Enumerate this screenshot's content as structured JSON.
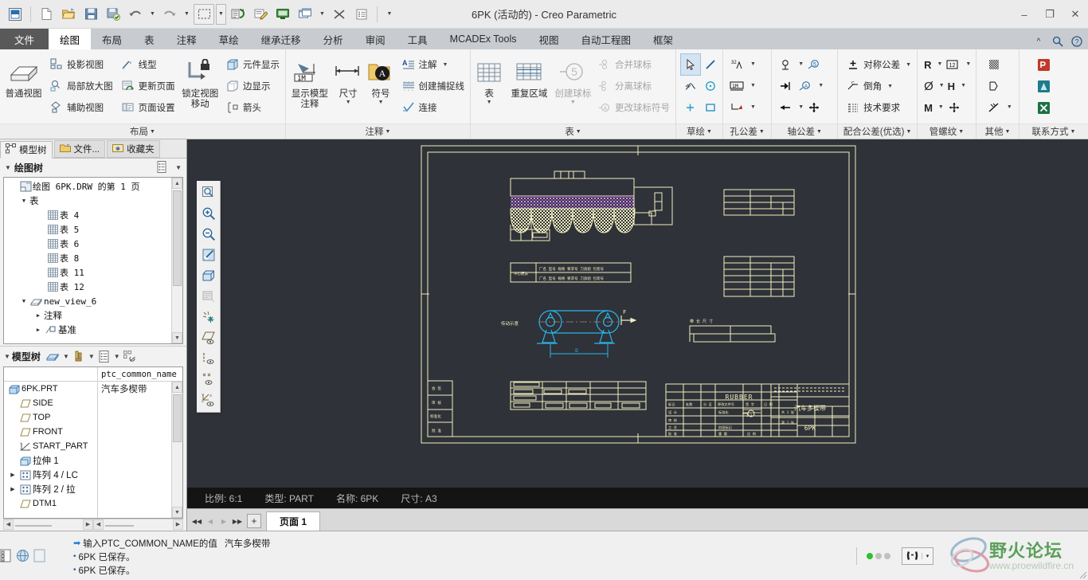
{
  "window": {
    "title": "6PK (活动的) - Creo Parametric",
    "minimize": "–",
    "maximize": "❐",
    "close": "✕"
  },
  "quick_access": {
    "items": [
      {
        "name": "app-menu-icon",
        "glyph": "app"
      },
      {
        "name": "new-icon",
        "glyph": "new"
      },
      {
        "name": "open-icon",
        "glyph": "open"
      },
      {
        "name": "save-icon",
        "glyph": "save"
      },
      {
        "name": "save-as-icon",
        "glyph": "saveas"
      },
      {
        "name": "undo-icon",
        "glyph": "undo"
      },
      {
        "name": "redo-icon",
        "glyph": "redo"
      },
      {
        "name": "select-box-icon",
        "glyph": "selbox"
      },
      {
        "name": "regenerate-icon",
        "glyph": "regen"
      },
      {
        "name": "annotate-icon",
        "glyph": "annot"
      },
      {
        "name": "display-icon",
        "glyph": "disp"
      },
      {
        "name": "window-icon",
        "glyph": "win"
      },
      {
        "name": "close-window-icon",
        "glyph": "closewin"
      },
      {
        "name": "list-icon",
        "glyph": "list"
      },
      {
        "name": "qat-overflow-icon",
        "glyph": "caret"
      }
    ]
  },
  "ribbon": {
    "tabs": [
      {
        "label": "文件",
        "id": "file",
        "state": "file"
      },
      {
        "label": "绘图",
        "id": "draw",
        "state": "active"
      },
      {
        "label": "布局",
        "id": "layout",
        "state": "normal"
      },
      {
        "label": "表",
        "id": "table",
        "state": "normal"
      },
      {
        "label": "注释",
        "id": "annotate",
        "state": "normal"
      },
      {
        "label": "草绘",
        "id": "sketch",
        "state": "normal"
      },
      {
        "label": "继承迁移",
        "id": "inherit",
        "state": "normal"
      },
      {
        "label": "分析",
        "id": "analysis",
        "state": "normal"
      },
      {
        "label": "审阅",
        "id": "review",
        "state": "normal"
      },
      {
        "label": "工具",
        "id": "tools",
        "state": "normal"
      },
      {
        "label": "MCADEx Tools",
        "id": "mcadex",
        "state": "normal"
      },
      {
        "label": "视图",
        "id": "view",
        "state": "normal"
      },
      {
        "label": "自动工程图",
        "id": "autodrawing",
        "state": "normal"
      },
      {
        "label": "框架",
        "id": "frame",
        "state": "normal"
      }
    ],
    "tab_right_icons": [
      {
        "name": "ribbon-collapse-icon",
        "glyph": "^"
      },
      {
        "name": "search-icon",
        "glyph": "search"
      },
      {
        "name": "help-icon",
        "glyph": "?"
      }
    ],
    "groups": [
      {
        "id": "layout",
        "label": "布局",
        "has_dialog_launcher": true,
        "big_button": {
          "label_line1": "普通视图",
          "label_line2": "",
          "icon": "general-view-icon"
        },
        "columns": [
          {
            "items": [
              {
                "label": "投影视图",
                "icon": "projection-view-icon",
                "enabled": true
              },
              {
                "label": "局部放大图",
                "icon": "detailed-view-icon",
                "enabled": true
              },
              {
                "label": "辅助视图",
                "icon": "auxiliary-view-icon",
                "enabled": true
              }
            ]
          },
          {
            "items": [
              {
                "label": "线型",
                "icon": "line-style-icon",
                "enabled": true
              },
              {
                "label": "更新页面",
                "icon": "update-sheet-icon",
                "enabled": true
              },
              {
                "label": "页面设置",
                "icon": "page-setup-icon",
                "enabled": true
              }
            ]
          }
        ],
        "big_button2": {
          "label_line1": "锁定视图",
          "label_line2": "移动",
          "icon": "lock-view-movement-icon"
        },
        "columns2": [
          {
            "items": [
              {
                "label": "元件显示",
                "icon": "component-display-icon",
                "enabled": true
              },
              {
                "label": "边显示",
                "icon": "edge-display-icon",
                "enabled": true
              },
              {
                "label": "箭头",
                "icon": "arrows-icon",
                "enabled": true
              }
            ]
          }
        ]
      },
      {
        "id": "annotation",
        "label": "注释",
        "has_dialog_launcher": true,
        "big_buttons": [
          {
            "label_line1": "显示模型",
            "label_line2": "注释",
            "icon": "show-model-annotations-icon",
            "caret": false
          },
          {
            "label_line1": "尺寸",
            "label_line2": "",
            "icon": "dimension-icon",
            "caret": true
          },
          {
            "label_line1": "符号",
            "label_line2": "",
            "icon": "symbol-icon",
            "caret": true
          }
        ],
        "columns": [
          {
            "items": [
              {
                "label": "注解",
                "icon": "note-icon",
                "enabled": true,
                "caret": true
              },
              {
                "label": "创建捕捉线",
                "icon": "create-snap-line-icon",
                "enabled": true
              },
              {
                "label": "连接",
                "icon": "connect-icon",
                "enabled": true
              }
            ]
          }
        ]
      },
      {
        "id": "table",
        "label": "表",
        "has_dialog_launcher": true,
        "big_buttons": [
          {
            "label_line1": "表",
            "label_line2": "",
            "icon": "table-icon",
            "caret": true
          },
          {
            "label_line1": "重复区域",
            "label_line2": "",
            "icon": "repeat-region-icon",
            "caret": false
          },
          {
            "label_line1": "创建球标",
            "label_line2": "",
            "icon": "create-balloon-icon",
            "caret": true,
            "enabled": false
          }
        ],
        "columns": [
          {
            "items": [
              {
                "label": "合并球标",
                "icon": "merge-balloons-icon",
                "enabled": false
              },
              {
                "label": "分离球标",
                "icon": "split-balloons-icon",
                "enabled": false
              },
              {
                "label": "更改球标符号",
                "icon": "change-balloon-symbol-icon",
                "enabled": false
              }
            ]
          }
        ]
      },
      {
        "id": "sketch",
        "label": "草绘",
        "has_dialog_launcher": true,
        "icon_grid": [
          [
            {
              "name": "select-tool-icon",
              "selected": true
            },
            {
              "name": "line-tool-icon",
              "selected": false
            }
          ],
          [
            {
              "name": "spline-tool-icon",
              "selected": false
            },
            {
              "name": "circle-tool-icon",
              "selected": false
            }
          ],
          [
            {
              "name": "point-tool-icon",
              "selected": false
            },
            {
              "name": "rectangle-tool-icon",
              "selected": false
            }
          ]
        ]
      },
      {
        "id": "hole-tolerance",
        "label": "孔公差",
        "has_dialog_launcher": true,
        "rows": [
          {
            "name": "surface-finish-32-icon",
            "text": "32",
            "caret": true
          },
          {
            "name": "datum-1m-icon",
            "text": "1M",
            "caret": true
          },
          {
            "name": "geometric-tolerance-icon",
            "text": "",
            "caret": true
          }
        ]
      },
      {
        "id": "shaft-tolerance",
        "label": "轴公差",
        "has_dialog_launcher": true,
        "rows": [
          {
            "name": "datum-feature-icon",
            "caret": true,
            "second": "balloon-5-icon",
            "second_caret": false
          },
          {
            "name": "datum-target-icon",
            "caret": false,
            "second": "balloon-detail-icon",
            "second_caret": true
          },
          {
            "name": "leader-arrow-icon",
            "caret": true,
            "second": "crosshair-icon",
            "second_caret": false
          }
        ]
      },
      {
        "id": "fit-tolerance",
        "label": "配合公差(优选)",
        "has_dialog_launcher": true,
        "columns": [
          {
            "items": [
              {
                "label": "对称公差",
                "icon": "symmetric-tolerance-icon",
                "enabled": true,
                "caret": true
              },
              {
                "label": "倒角",
                "icon": "chamfer-icon",
                "enabled": true,
                "caret": true
              },
              {
                "label": "技术要求",
                "icon": "technical-requirements-icon",
                "enabled": true
              }
            ]
          }
        ]
      },
      {
        "id": "pipe-thread",
        "label": "管螺纹",
        "has_dialog_launcher": true,
        "text_grid": [
          [
            {
              "t": "R",
              "caret": true
            },
            {
              "t": "12",
              "caret": true,
              "boxed": true
            }
          ],
          [
            {
              "t": "Ø",
              "caret": true
            },
            {
              "t": "H",
              "caret": true
            }
          ],
          [
            {
              "t": "M",
              "caret": true
            },
            {
              "t": "crosshair",
              "caret": false
            }
          ]
        ]
      },
      {
        "id": "other",
        "label": "其他",
        "has_dialog_launcher": true,
        "icons": [
          {
            "name": "hatch-pattern-icon",
            "caret": false
          },
          {
            "name": "section-symbol-icon",
            "caret": false
          },
          {
            "name": "crossed-lines-icon",
            "caret": true
          }
        ]
      },
      {
        "id": "contact",
        "label": "联系方式",
        "has_dialog_launcher": true,
        "icons": [
          {
            "name": "pdf-export-icon",
            "color": "#c0392b"
          },
          {
            "name": "acrobat-export-icon",
            "color": "#1f7a8c"
          },
          {
            "name": "excel-export-icon",
            "color": "#1e7145"
          }
        ]
      }
    ]
  },
  "left_panel": {
    "nav_tabs": [
      {
        "label": "模型树",
        "icon": "model-tree-icon",
        "active": true
      },
      {
        "label": "文件...",
        "icon": "folder-icon",
        "active": false
      },
      {
        "label": "收藏夹",
        "icon": "favorites-icon",
        "active": false
      }
    ],
    "drawing_tree": {
      "header": "绘图树",
      "settings_icon": "tree-settings-icon",
      "menu_icon": "tree-menu-icon",
      "nodes": [
        {
          "indent": 0,
          "expander": "",
          "icon": "sheet-icon",
          "label": "绘图 6PK.DRW 的第 1 页",
          "mono": true
        },
        {
          "indent": 1,
          "expander": "▼",
          "icon": "",
          "label": "表",
          "mono": false
        },
        {
          "indent": 3,
          "expander": "",
          "icon": "table-small-icon",
          "label": "表 4",
          "mono": true
        },
        {
          "indent": 3,
          "expander": "",
          "icon": "table-small-icon",
          "label": "表 5",
          "mono": true
        },
        {
          "indent": 3,
          "expander": "",
          "icon": "table-small-icon",
          "label": "表 6",
          "mono": true
        },
        {
          "indent": 3,
          "expander": "",
          "icon": "table-small-icon",
          "label": "表 8",
          "mono": true
        },
        {
          "indent": 3,
          "expander": "",
          "icon": "table-small-icon",
          "label": "表 11",
          "mono": true
        },
        {
          "indent": 3,
          "expander": "",
          "icon": "table-small-icon",
          "label": "表 12",
          "mono": true
        },
        {
          "indent": 1,
          "expander": "▼",
          "icon": "view-icon",
          "label": "new_view_6",
          "mono": true
        },
        {
          "indent": 2,
          "expander": "▶",
          "icon": "",
          "label": "注释",
          "mono": false
        },
        {
          "indent": 2,
          "expander": "▶",
          "icon": "datum-icon",
          "label": "基准",
          "mono": false
        }
      ]
    },
    "model_tree": {
      "header": "模型树",
      "toolbar_icons": [
        "model-display-icon",
        "filter-icon",
        "settings-list-icon",
        "tree-columns-icon"
      ],
      "column_header": "ptc_common_name",
      "nodes": [
        {
          "indent": 0,
          "expander": "",
          "icon": "part-icon",
          "label": "6PK.PRT",
          "value": "汽车多楔带"
        },
        {
          "indent": 1,
          "expander": "",
          "icon": "plane-icon",
          "label": "SIDE",
          "value": ""
        },
        {
          "indent": 1,
          "expander": "",
          "icon": "plane-icon",
          "label": "TOP",
          "value": ""
        },
        {
          "indent": 1,
          "expander": "",
          "icon": "plane-icon",
          "label": "FRONT",
          "value": ""
        },
        {
          "indent": 1,
          "expander": "",
          "icon": "csys-icon",
          "label": "START_PART",
          "value": ""
        },
        {
          "indent": 1,
          "expander": "",
          "icon": "extrude-icon",
          "label": "拉伸 1",
          "value": ""
        },
        {
          "indent": 1,
          "expander": "▶",
          "icon": "pattern-icon",
          "label": "阵列 4 / LC",
          "value": ""
        },
        {
          "indent": 1,
          "expander": "▶",
          "icon": "pattern-icon",
          "label": "阵列 2 / 拉",
          "value": ""
        },
        {
          "indent": 1,
          "expander": "",
          "icon": "plane-icon",
          "label": "DTM1",
          "value": ""
        }
      ]
    }
  },
  "canvas": {
    "vertical_toolbar": [
      {
        "name": "zoom-fit-icon"
      },
      {
        "name": "zoom-in-icon"
      },
      {
        "name": "zoom-out-icon"
      },
      {
        "name": "repaint-icon"
      },
      {
        "name": "display-style-icon"
      },
      {
        "name": "saved-views-icon",
        "disabled": true
      },
      {
        "name": "datum-display-all-icon"
      },
      {
        "name": "plane-display-icon"
      },
      {
        "name": "axis-display-icon"
      },
      {
        "name": "point-display-icon"
      },
      {
        "name": "csys-display-icon"
      }
    ],
    "drawing": {
      "view_label": "传动示意",
      "section_arrow": "F",
      "dimension_label": "D",
      "title_block": {
        "material": "RUBBER",
        "part_name": "汽车多楔带",
        "part_number": "6PK"
      }
    }
  },
  "status": {
    "scale_label": "比例: 6:1",
    "type_label": "类型: PART",
    "name_label": "名称: 6PK",
    "size_label": "尺寸: A3"
  },
  "page_bar": {
    "nav": [
      {
        "name": "first-page-button",
        "glyph": "◀◀",
        "disabled": false
      },
      {
        "name": "prev-page-button",
        "glyph": "◀",
        "disabled": true
      },
      {
        "name": "next-page-button",
        "glyph": "▶",
        "disabled": true
      },
      {
        "name": "last-page-button",
        "glyph": "▶▶",
        "disabled": false
      }
    ],
    "add_label": "+",
    "tabs": [
      {
        "label": "页面 1",
        "active": true
      }
    ]
  },
  "messages": {
    "icons": [
      "message-log-icon",
      "web-icon",
      "blank-icon"
    ],
    "lines": [
      {
        "type": "input",
        "prompt": "输入PTC_COMMON_NAME的值",
        "value": "汽车多楔带"
      },
      {
        "type": "info",
        "text": "6PK 已保存。"
      },
      {
        "type": "info",
        "text": "6PK 已保存。"
      }
    ]
  },
  "status_right": {
    "dots": [
      true,
      false,
      false
    ],
    "find_icon": "find-icon",
    "find_caret": "▾",
    "watermark_text": "野火论坛",
    "watermark_url": "www.proewildfire.cn"
  },
  "colors": {
    "ribbon_bg": "#f5f5f5",
    "tabbar_bg": "#c8ccd0",
    "canvas_bg": "#2f3238",
    "cad_yellow": "#f2efc0",
    "cad_cyan": "#29b6e8",
    "cad_magenta": "#a050c0",
    "status_bg": "#141414",
    "accent_blue": "#1f7fd4"
  }
}
